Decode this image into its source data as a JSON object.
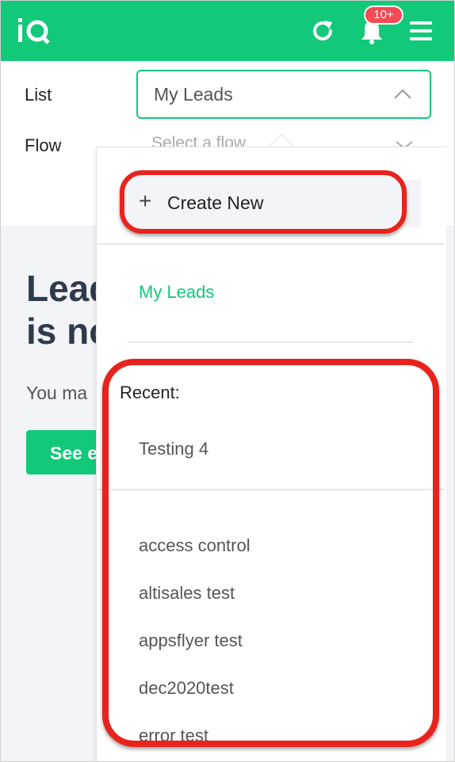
{
  "header": {
    "logo_text": "iQ",
    "badge": "10+",
    "icons": [
      "refresh-icon",
      "bell-icon",
      "hamburger-menu-icon"
    ],
    "brand_color": "#12c97a",
    "badge_color": "#f44b55"
  },
  "form": {
    "list_label": "List",
    "list_value": "My Leads",
    "flow_label": "Flow",
    "flow_placeholder": "Select a flow"
  },
  "background": {
    "title": "Lead\nis no",
    "subtitle": "You ma",
    "button": "See e"
  },
  "dropdown": {
    "create_new": "Create New",
    "selected_item": "My Leads",
    "recent_label": "Recent:",
    "recent_items": [
      "Testing 4"
    ],
    "items": [
      "access control",
      "altisales test",
      "appsflyer test",
      "dec2020test",
      "error test"
    ],
    "annotation_color": "#e8231d"
  }
}
